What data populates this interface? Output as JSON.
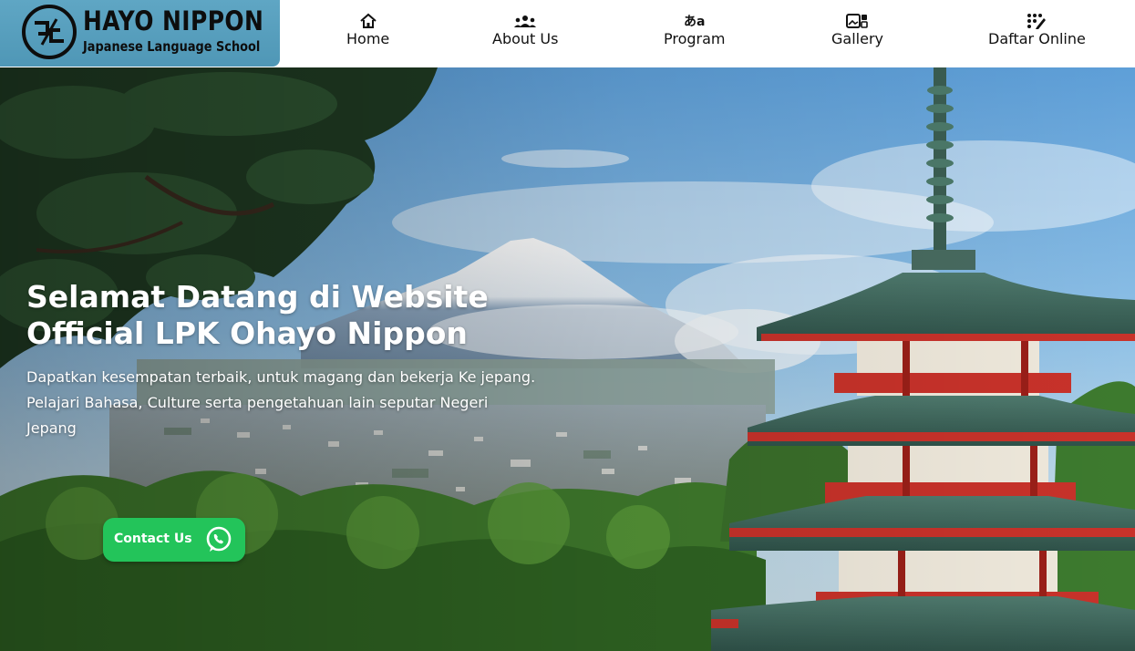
{
  "brand": {
    "name": "HAYO NIPPON",
    "tagline": "Japanese Language School"
  },
  "nav": [
    {
      "label": "Home",
      "icon": "home-icon"
    },
    {
      "label": "About Us",
      "icon": "users-icon"
    },
    {
      "label": "Program",
      "icon": "language-icon",
      "glyph": "あa"
    },
    {
      "label": "Gallery",
      "icon": "gallery-icon"
    },
    {
      "label": "Daftar Online",
      "icon": "register-icon"
    }
  ],
  "hero": {
    "title": "Selamat Datang di Website Official LPK Ohayo Nippon",
    "description": "Dapatkan kesempatan terbaik, untuk magang dan bekerja Ke jepang. Pelajari Bahasa, Culture serta pengetahuan lain seputar Negeri Jepang",
    "cta_label": "Contact Us",
    "cta_icon": "whatsapp-icon"
  },
  "colors": {
    "logo_bg": "#5fa6c4",
    "cta_green": "#23c45a",
    "logo_accent_red": "#e0191f"
  }
}
